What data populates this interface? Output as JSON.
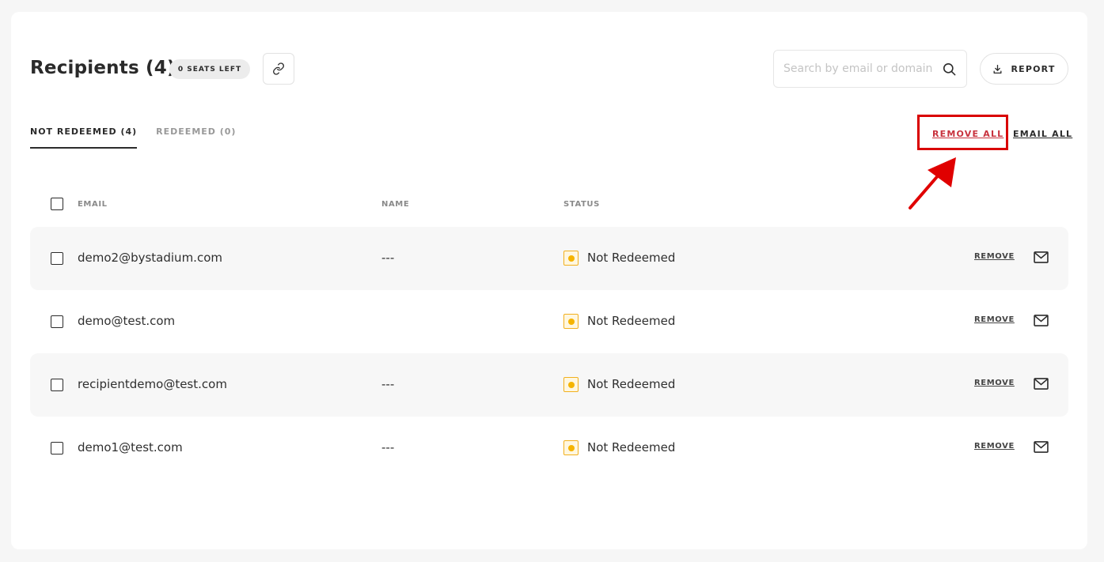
{
  "header": {
    "title": "Recipients (4)",
    "seats_badge": "0 SEATS LEFT",
    "search_placeholder": "Search by email or domain",
    "report_label": "REPORT"
  },
  "tabs": [
    {
      "label": "NOT REDEEMED (4)",
      "active": true
    },
    {
      "label": "REDEEMED (0)",
      "active": false
    }
  ],
  "actions": {
    "remove_all": "REMOVE ALL",
    "email_all": "EMAIL ALL"
  },
  "table": {
    "columns": [
      "EMAIL",
      "NAME",
      "STATUS"
    ],
    "rows": [
      {
        "email": "demo2@bystadium.com",
        "name": "---",
        "status": "Not Redeemed",
        "remove": "REMOVE"
      },
      {
        "email": "demo@test.com",
        "name": "",
        "status": "Not Redeemed",
        "remove": "REMOVE"
      },
      {
        "email": "recipientdemo@test.com",
        "name": "---",
        "status": "Not Redeemed",
        "remove": "REMOVE"
      },
      {
        "email": "demo1@test.com",
        "name": "---",
        "status": "Not Redeemed",
        "remove": "REMOVE"
      }
    ]
  },
  "icons": {
    "link": "link-icon",
    "search": "search-icon",
    "download": "download-icon",
    "mail": "mail-icon",
    "status": "status-dot-icon"
  },
  "colors": {
    "accent_red": "#c8323d",
    "annotation_red": "#d90000",
    "status_yellow": "#f5b400",
    "row_shade": "#f7f7f7",
    "page_bg": "#f6f6f6"
  }
}
